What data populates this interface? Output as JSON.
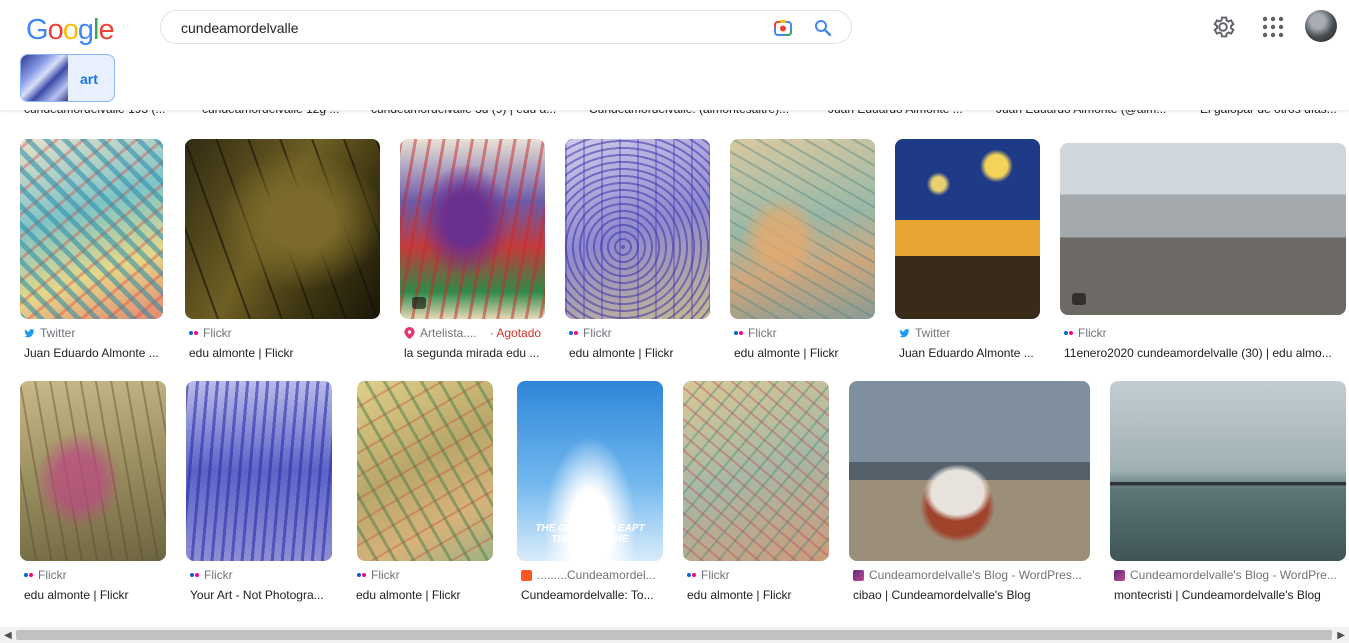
{
  "logo": {
    "letters": [
      "G",
      "o",
      "o",
      "g",
      "l",
      "e"
    ],
    "colors": [
      "#4285f4",
      "#ea4335",
      "#fbbc05",
      "#4285f4",
      "#34a853",
      "#ea4335"
    ]
  },
  "search": {
    "query": "cundeamordelvalle"
  },
  "chip": {
    "label": "art"
  },
  "top_captions": [
    "cundeamordelvalle 193 (...",
    "cundeamordelvalle 12g ...",
    "cundeamordelvalle 3d (9) | edu a...",
    "Cundeamordelvalle: (almontesaltre)...",
    "Juan Eduardo Almonte ...",
    "Juan Eduardo Almonte (@alm...",
    "El galopar de otros días..."
  ],
  "row1": [
    {
      "source": "Twitter",
      "title": "Juan Eduardo Almonte ..."
    },
    {
      "source": "Flickr",
      "title": "edu almonte | Flickr"
    },
    {
      "source": "Artelista....",
      "extra": "· Agotado",
      "title": "la segunda mirada edu ..."
    },
    {
      "source": "Flickr",
      "title": "edu almonte | Flickr"
    },
    {
      "source": "Flickr",
      "title": "edu almonte | Flickr"
    },
    {
      "source": "Twitter",
      "title": "Juan Eduardo Almonte ..."
    },
    {
      "source": "Flickr",
      "title": "11enero2020 cundeamordelvalle (30) | edu almo..."
    }
  ],
  "row2": [
    {
      "source": "Flickr",
      "title": "edu almonte | Flickr"
    },
    {
      "source": "Flickr",
      "title": "Your Art - Not Photogra..."
    },
    {
      "source": "Flickr",
      "title": "edu almonte | Flickr"
    },
    {
      "source": ".........Cundeamordel...",
      "title": "Cundeamordelvalle: To..."
    },
    {
      "source": "Flickr",
      "title": "edu almonte | Flickr"
    },
    {
      "source": "Cundeamordelvalle's Blog - WordPres...",
      "title": "cibao | Cundeamordelvalle's Blog"
    },
    {
      "source": "Cundeamordelvalle's Blog - WordPre...",
      "title": "montecristi | Cundeamordelvalle's Blog"
    }
  ],
  "poster": {
    "line1": "THE GIRL WHO LEAPT",
    "line2": "THROUGH TIME"
  },
  "icons": {
    "camera": "lens-camera-icon",
    "search": "search-icon",
    "settings": "gear-icon",
    "apps": "apps-grid-icon"
  }
}
